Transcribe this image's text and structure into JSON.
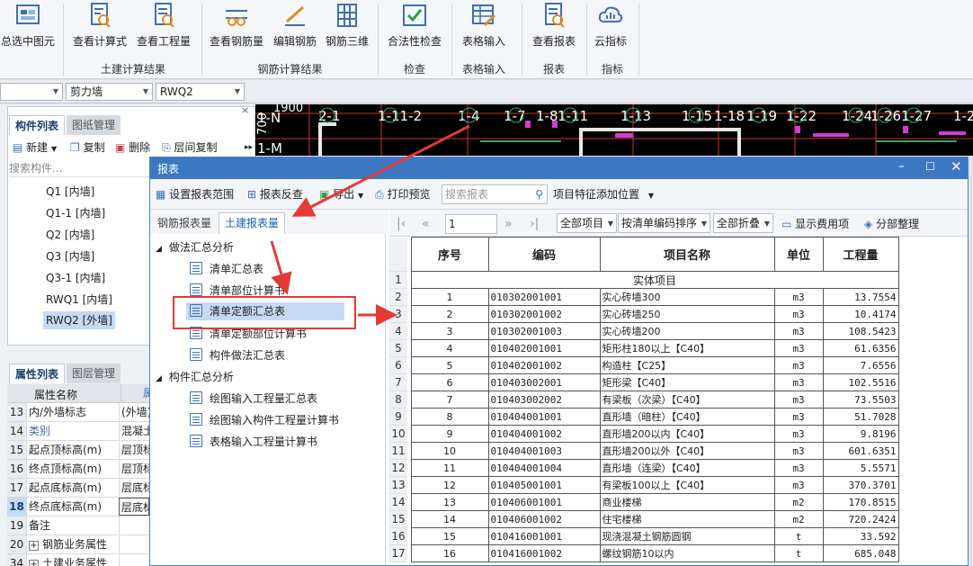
{
  "ribbon": {
    "buttons": [
      {
        "label": "总选中图元",
        "icon": "select-all-icon"
      },
      {
        "label": "查看计算式",
        "icon": "view-formula-icon"
      },
      {
        "label": "查看工程量",
        "icon": "view-quantity-icon"
      },
      {
        "label": "查看钢筋量",
        "icon": "view-rebar-icon"
      },
      {
        "label": "编辑钢筋",
        "icon": "edit-rebar-icon"
      },
      {
        "label": "钢筋三维",
        "icon": "rebar-3d-icon"
      },
      {
        "label": "合法性检查",
        "icon": "validity-check-icon"
      },
      {
        "label": "表格输入",
        "icon": "table-input-icon"
      },
      {
        "label": "查看报表",
        "icon": "view-report-icon"
      },
      {
        "label": "云指标",
        "icon": "cloud-index-icon"
      }
    ],
    "groups": {
      "civil": "土建计算结果",
      "rebar": "钢筋计算结果",
      "check": "检查",
      "table": "表格输入",
      "report": "报表",
      "index": "指标"
    }
  },
  "selectors": {
    "sel1": "",
    "sel2": "剪力墙",
    "sel3": "RWQ2"
  },
  "left": {
    "tabs": {
      "components": "构件列表",
      "drawings": "图纸管理"
    },
    "toolbar": {
      "new": "新建",
      "copy": "复制",
      "delete": "删除",
      "floor_copy": "层间复制"
    },
    "search_placeholder": "搜索构件...",
    "tree": [
      "Q1 [内墙]",
      "Q1-1 [内墙]",
      "Q2 [内墙]",
      "Q3 [内墙]",
      "Q3-1 [内墙]",
      "RWQ1 [内墙]",
      "RWQ2 [外墙]"
    ],
    "prop_tabs": {
      "props": "属性列表",
      "layers": "图层管理"
    },
    "prop_header": {
      "name": "属性名称",
      "value": "属"
    },
    "props": [
      {
        "num": "13",
        "name": "内/外墙标志",
        "value": "(外墙)"
      },
      {
        "num": "14",
        "name": "类别",
        "value": "混凝土"
      },
      {
        "num": "15",
        "name": "起点顶标高(m)",
        "value": "层顶标"
      },
      {
        "num": "16",
        "name": "终点顶标高(m)",
        "value": "层顶标"
      },
      {
        "num": "17",
        "name": "起点底标高(m)",
        "value": "层底标"
      },
      {
        "num": "18",
        "name": "终点底标高(m)",
        "value": "层底标"
      },
      {
        "num": "19",
        "name": "备注",
        "value": ""
      },
      {
        "num": "20",
        "name": "钢筋业务属性",
        "value": ""
      },
      {
        "num": "34",
        "name": "土建业务属性",
        "value": ""
      }
    ]
  },
  "cad": {
    "labels": [
      "1900",
      "1-N",
      "2-1",
      "1-11-2",
      "1-4",
      "1-7",
      "1-8",
      "1-11",
      "1-13",
      "1-15",
      "1-18",
      "1-19",
      "1-22",
      "1-24",
      "1-26",
      "1-27",
      "1-2"
    ],
    "dims": [
      "700",
      "1-M"
    ]
  },
  "dialog": {
    "title": "报表",
    "toolbar": {
      "set_range": "设置报表范围",
      "reverse": "报表反查",
      "export": "导出",
      "print_preview": "打印预览",
      "search_placeholder": "搜索报表",
      "add_feature": "项目特征添加位置"
    },
    "tabs": {
      "rebar": "钢筋报表量",
      "civil": "土建报表量"
    },
    "nav": {
      "group1": "做法汇总分析",
      "group1_items": [
        "清单汇总表",
        "清单部位计算书",
        "清单定额汇总表",
        "清单定额部位计算书",
        "构件做法汇总表"
      ],
      "group2": "构件汇总分析",
      "group2_items": [
        "绘图输入工程量汇总表",
        "绘图输入构件工程量计算书",
        "表格输入工程量计算书"
      ]
    },
    "pager": {
      "page": "1",
      "all_items": "全部项目",
      "sort": "按清单编码排序",
      "fold": "全部折叠",
      "show_fee": "显示费用项",
      "arrange": "分部整理"
    },
    "table": {
      "headers": [
        "序号",
        "编码",
        "项目名称",
        "单位",
        "工程量"
      ],
      "section": "实体项目",
      "rows": [
        [
          "1",
          "010302001001",
          "实心砖墙300",
          "m3",
          "13.7554"
        ],
        [
          "2",
          "010302001002",
          "实心砖墙250",
          "m3",
          "10.4174"
        ],
        [
          "3",
          "010302001003",
          "实心砖墙200",
          "m3",
          "108.5423"
        ],
        [
          "4",
          "010402001001",
          "矩形柱180以上【C40】",
          "m3",
          "61.6356"
        ],
        [
          "5",
          "010402001002",
          "构造柱【C25】",
          "m3",
          "7.6556"
        ],
        [
          "6",
          "010403002001",
          "矩形梁【C40】",
          "m3",
          "102.5516"
        ],
        [
          "7",
          "010403002002",
          "有梁板（次梁）【C40】",
          "m3",
          "73.5503"
        ],
        [
          "8",
          "010404001001",
          "直形墙（暗柱）【C40】",
          "m3",
          "51.7028"
        ],
        [
          "9",
          "010404001002",
          "直形墙200以内【C40】",
          "m3",
          "9.8196"
        ],
        [
          "10",
          "010404001003",
          "直形墙200以外【C40】",
          "m3",
          "601.6351"
        ],
        [
          "11",
          "010404001004",
          "直形墙（连梁）【C40】",
          "m3",
          "5.5571"
        ],
        [
          "12",
          "010405001001",
          "有梁板100以上【C40】",
          "m3",
          "370.3701"
        ],
        [
          "13",
          "010406001001",
          "商业楼梯",
          "m2",
          "170.8515"
        ],
        [
          "14",
          "010406001002",
          "住宅楼梯",
          "m2",
          "720.2424"
        ],
        [
          "15",
          "010416001001",
          "现浇混凝土钢筋圆钢",
          "t",
          "33.592"
        ],
        [
          "16",
          "010416001002",
          "螺纹钢筋10以内",
          "t",
          "685.048"
        ]
      ],
      "row_numbers": [
        "1",
        "2",
        "3",
        "4",
        "5",
        "6",
        "7",
        "8",
        "9",
        "10",
        "11",
        "12",
        "13",
        "14",
        "15",
        "16",
        "17"
      ]
    }
  },
  "colors": {
    "accent": "#3c78c2",
    "callout": "#e53935"
  }
}
